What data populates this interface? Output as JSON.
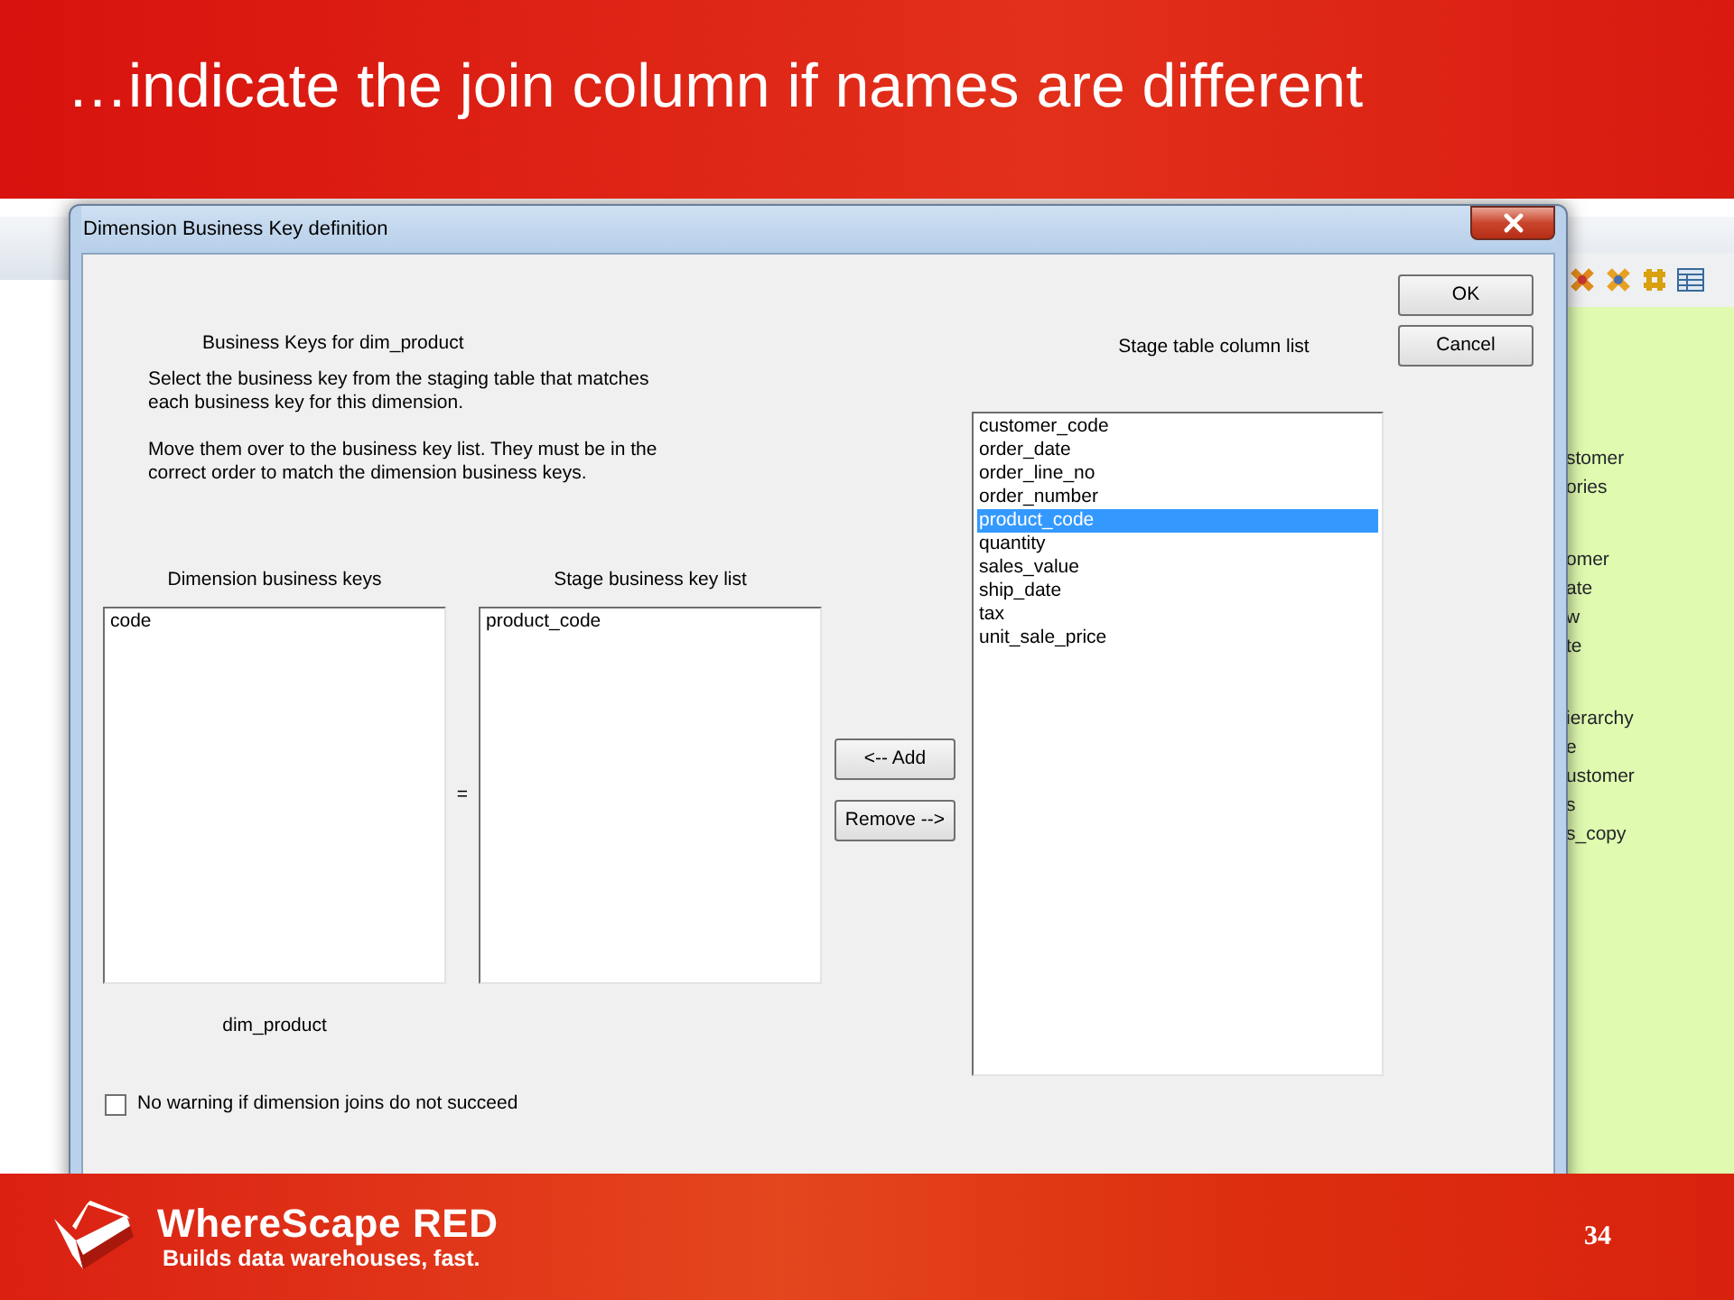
{
  "slide": {
    "title": "…indicate the join column if names are different"
  },
  "background_app": {
    "tree_groups": [
      [
        "stomer",
        "ories"
      ],
      [
        "omer",
        "ate",
        "w",
        "te"
      ],
      [
        "ierarchy",
        "e",
        "ustomer",
        "s",
        "s_copy"
      ]
    ]
  },
  "dialog": {
    "title": "Dimension Business Key definition",
    "heading": "Business Keys for dim_product",
    "instructions": [
      "Select the business key from the staging table that matches each business key for this dimension.",
      "Move them over to the business key list. They must be in the correct order to match the dimension business keys."
    ],
    "dimension_keys": {
      "label": "Dimension business keys",
      "items": [
        "code"
      ],
      "caption": "dim_product"
    },
    "equals": "=",
    "stage_keys": {
      "label": "Stage business key list",
      "items": [
        "product_code"
      ]
    },
    "move_buttons": [
      "<-- Add",
      "Remove -->"
    ],
    "column_list": {
      "label": "Stage table column list",
      "items": [
        {
          "text": "customer_code",
          "selected": false
        },
        {
          "text": "order_date",
          "selected": false
        },
        {
          "text": "order_line_no",
          "selected": false
        },
        {
          "text": "order_number",
          "selected": false
        },
        {
          "text": "product_code",
          "selected": true
        },
        {
          "text": "quantity",
          "selected": false
        },
        {
          "text": "sales_value",
          "selected": false
        },
        {
          "text": "ship_date",
          "selected": false
        },
        {
          "text": "tax",
          "selected": false
        },
        {
          "text": "unit_sale_price",
          "selected": false
        }
      ]
    },
    "buttons": [
      "OK",
      "Cancel"
    ],
    "checkbox": {
      "label": "No warning if dimension joins do not succeed",
      "checked": false
    }
  },
  "footer": {
    "brand": "WhereScape RED",
    "tagline": "Builds data warehouses, fast.",
    "page_number": "34"
  }
}
